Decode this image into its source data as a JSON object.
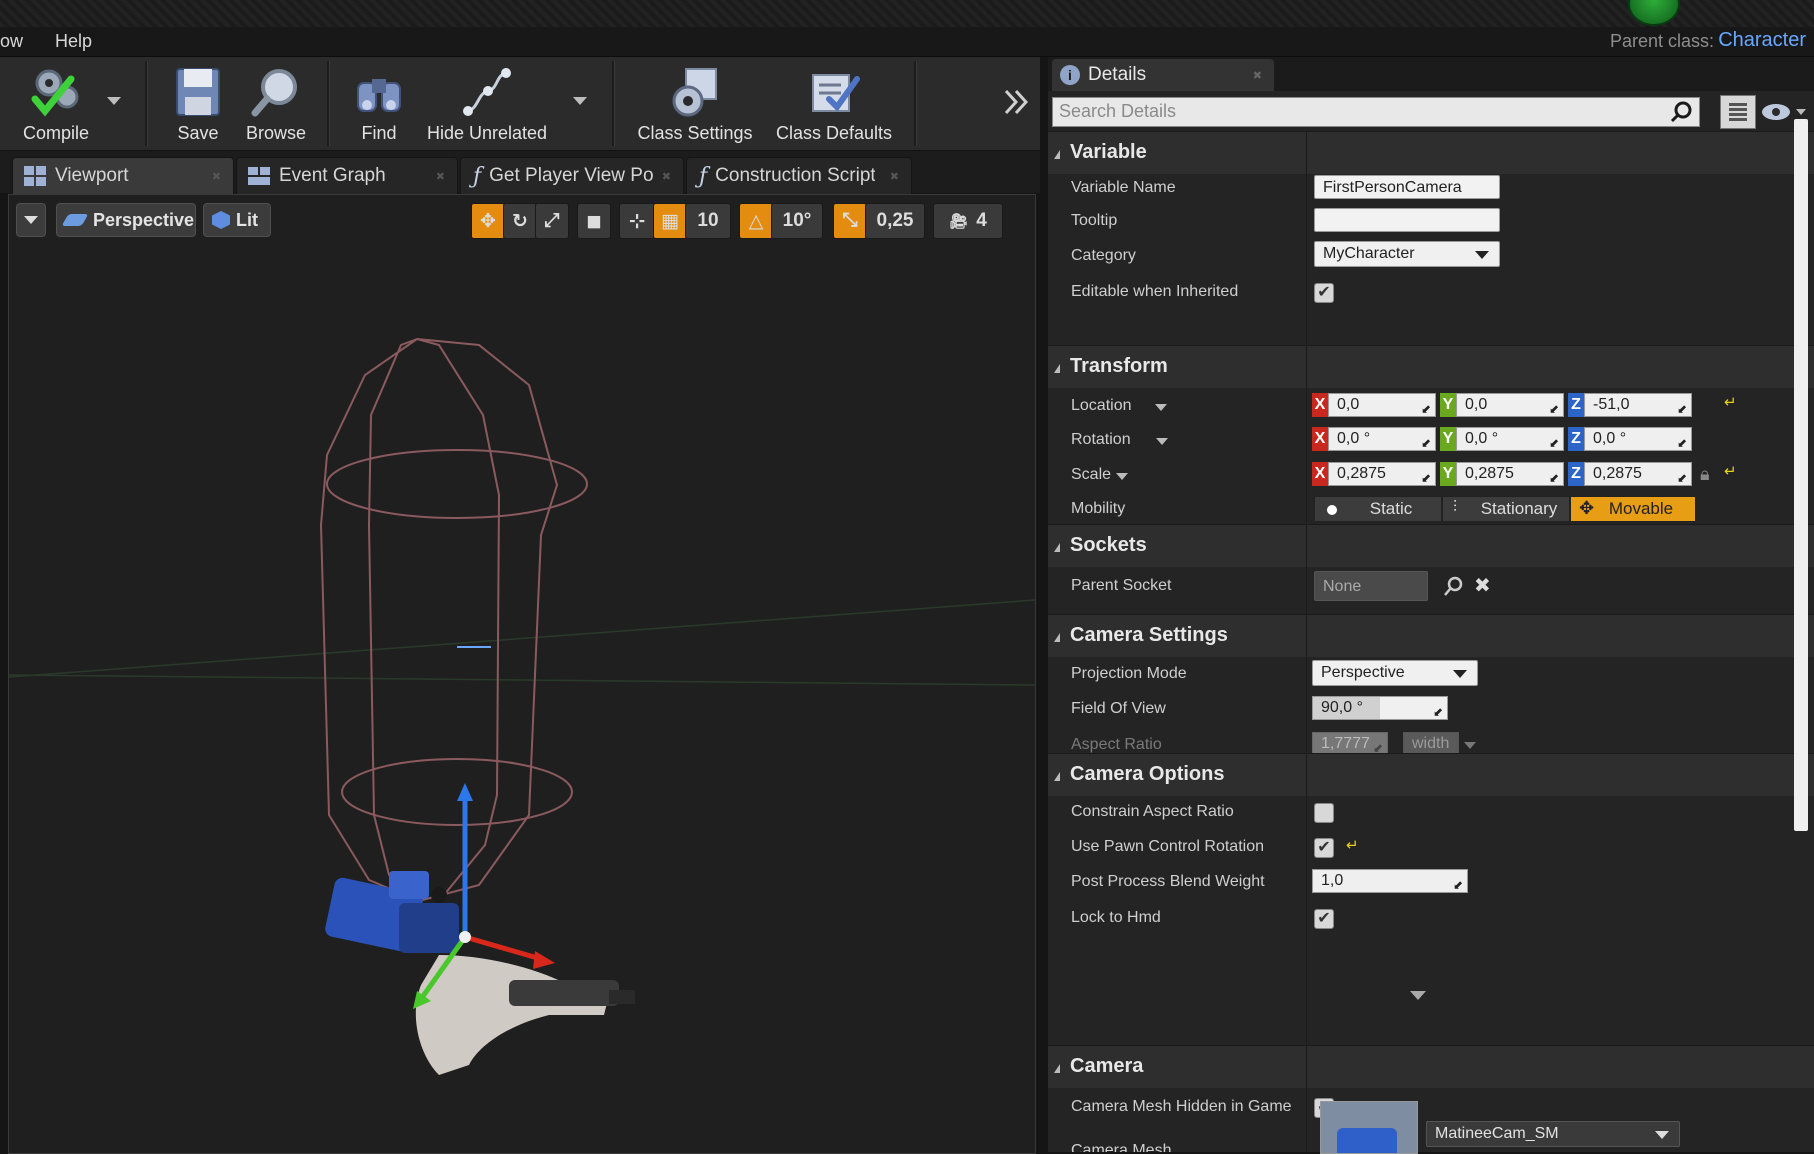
{
  "menubar": {
    "item_window": "ow",
    "item_help": "Help",
    "parent_class_label": "Parent class:",
    "parent_class_value": "Character"
  },
  "toolbar": {
    "compile": "Compile",
    "save": "Save",
    "browse": "Browse",
    "find": "Find",
    "hide_unrelated": "Hide Unrelated",
    "class_settings": "Class Settings",
    "class_defaults": "Class Defaults"
  },
  "tabs": [
    "Viewport",
    "Event Graph",
    "Get Player View Po",
    "Construction Script"
  ],
  "viewport": {
    "perspective": "Perspective",
    "lit": "Lit",
    "grid_snap": "10",
    "rotation_snap": "10°",
    "scale_snap": "0,25",
    "camera_speed": "4"
  },
  "details": {
    "tab_title": "Details",
    "search_placeholder": "Search Details",
    "variable": {
      "title": "Variable",
      "variable_name_label": "Variable Name",
      "variable_name_value": "FirstPersonCamera",
      "tooltip_label": "Tooltip",
      "tooltip_value": "",
      "category_label": "Category",
      "category_value": "MyCharacter",
      "editable_label": "Editable when Inherited",
      "editable_checked": true
    },
    "transform": {
      "title": "Transform",
      "location_label": "Location",
      "location": [
        "0,0",
        "0,0",
        "-51,0"
      ],
      "rotation_label": "Rotation",
      "rotation": [
        "0,0 °",
        "0,0 °",
        "0,0 °"
      ],
      "scale_label": "Scale",
      "scale": [
        "0,2875",
        "0,2875",
        "0,2875"
      ],
      "mobility_label": "Mobility",
      "mobility_options": [
        "Static",
        "Stationary",
        "Movable"
      ],
      "mobility_selected": "Movable"
    },
    "sockets": {
      "title": "Sockets",
      "parent_socket_label": "Parent Socket",
      "parent_socket_value": "None"
    },
    "camera_settings": {
      "title": "Camera Settings",
      "projection_label": "Projection Mode",
      "projection_value": "Perspective",
      "fov_label": "Field Of View",
      "fov_value": "90,0 °",
      "fov_fraction": 0.5,
      "aspect_label": "Aspect Ratio",
      "aspect_value": "1,7777",
      "aspect_mode": "width"
    },
    "camera_options": {
      "title": "Camera Options",
      "constrain_label": "Constrain Aspect Ratio",
      "constrain_checked": false,
      "pawn_label": "Use Pawn Control Rotation",
      "pawn_checked": true,
      "blend_label": "Post Process Blend Weight",
      "blend_value": "1,0",
      "hmd_label": "Lock to Hmd",
      "hmd_checked": true
    },
    "camera": {
      "title": "Camera",
      "hidden_label": "Camera Mesh Hidden in Game",
      "hidden_checked": true,
      "mesh_label": "Camera Mesh",
      "mesh_value": "MatineeCam_SM"
    }
  },
  "colors": {
    "accent_orange": "#e48c10",
    "link_blue": "#6aa7ff",
    "axis_x": "#c8281e",
    "axis_y": "#6aa820",
    "axis_z": "#2c64c8"
  }
}
